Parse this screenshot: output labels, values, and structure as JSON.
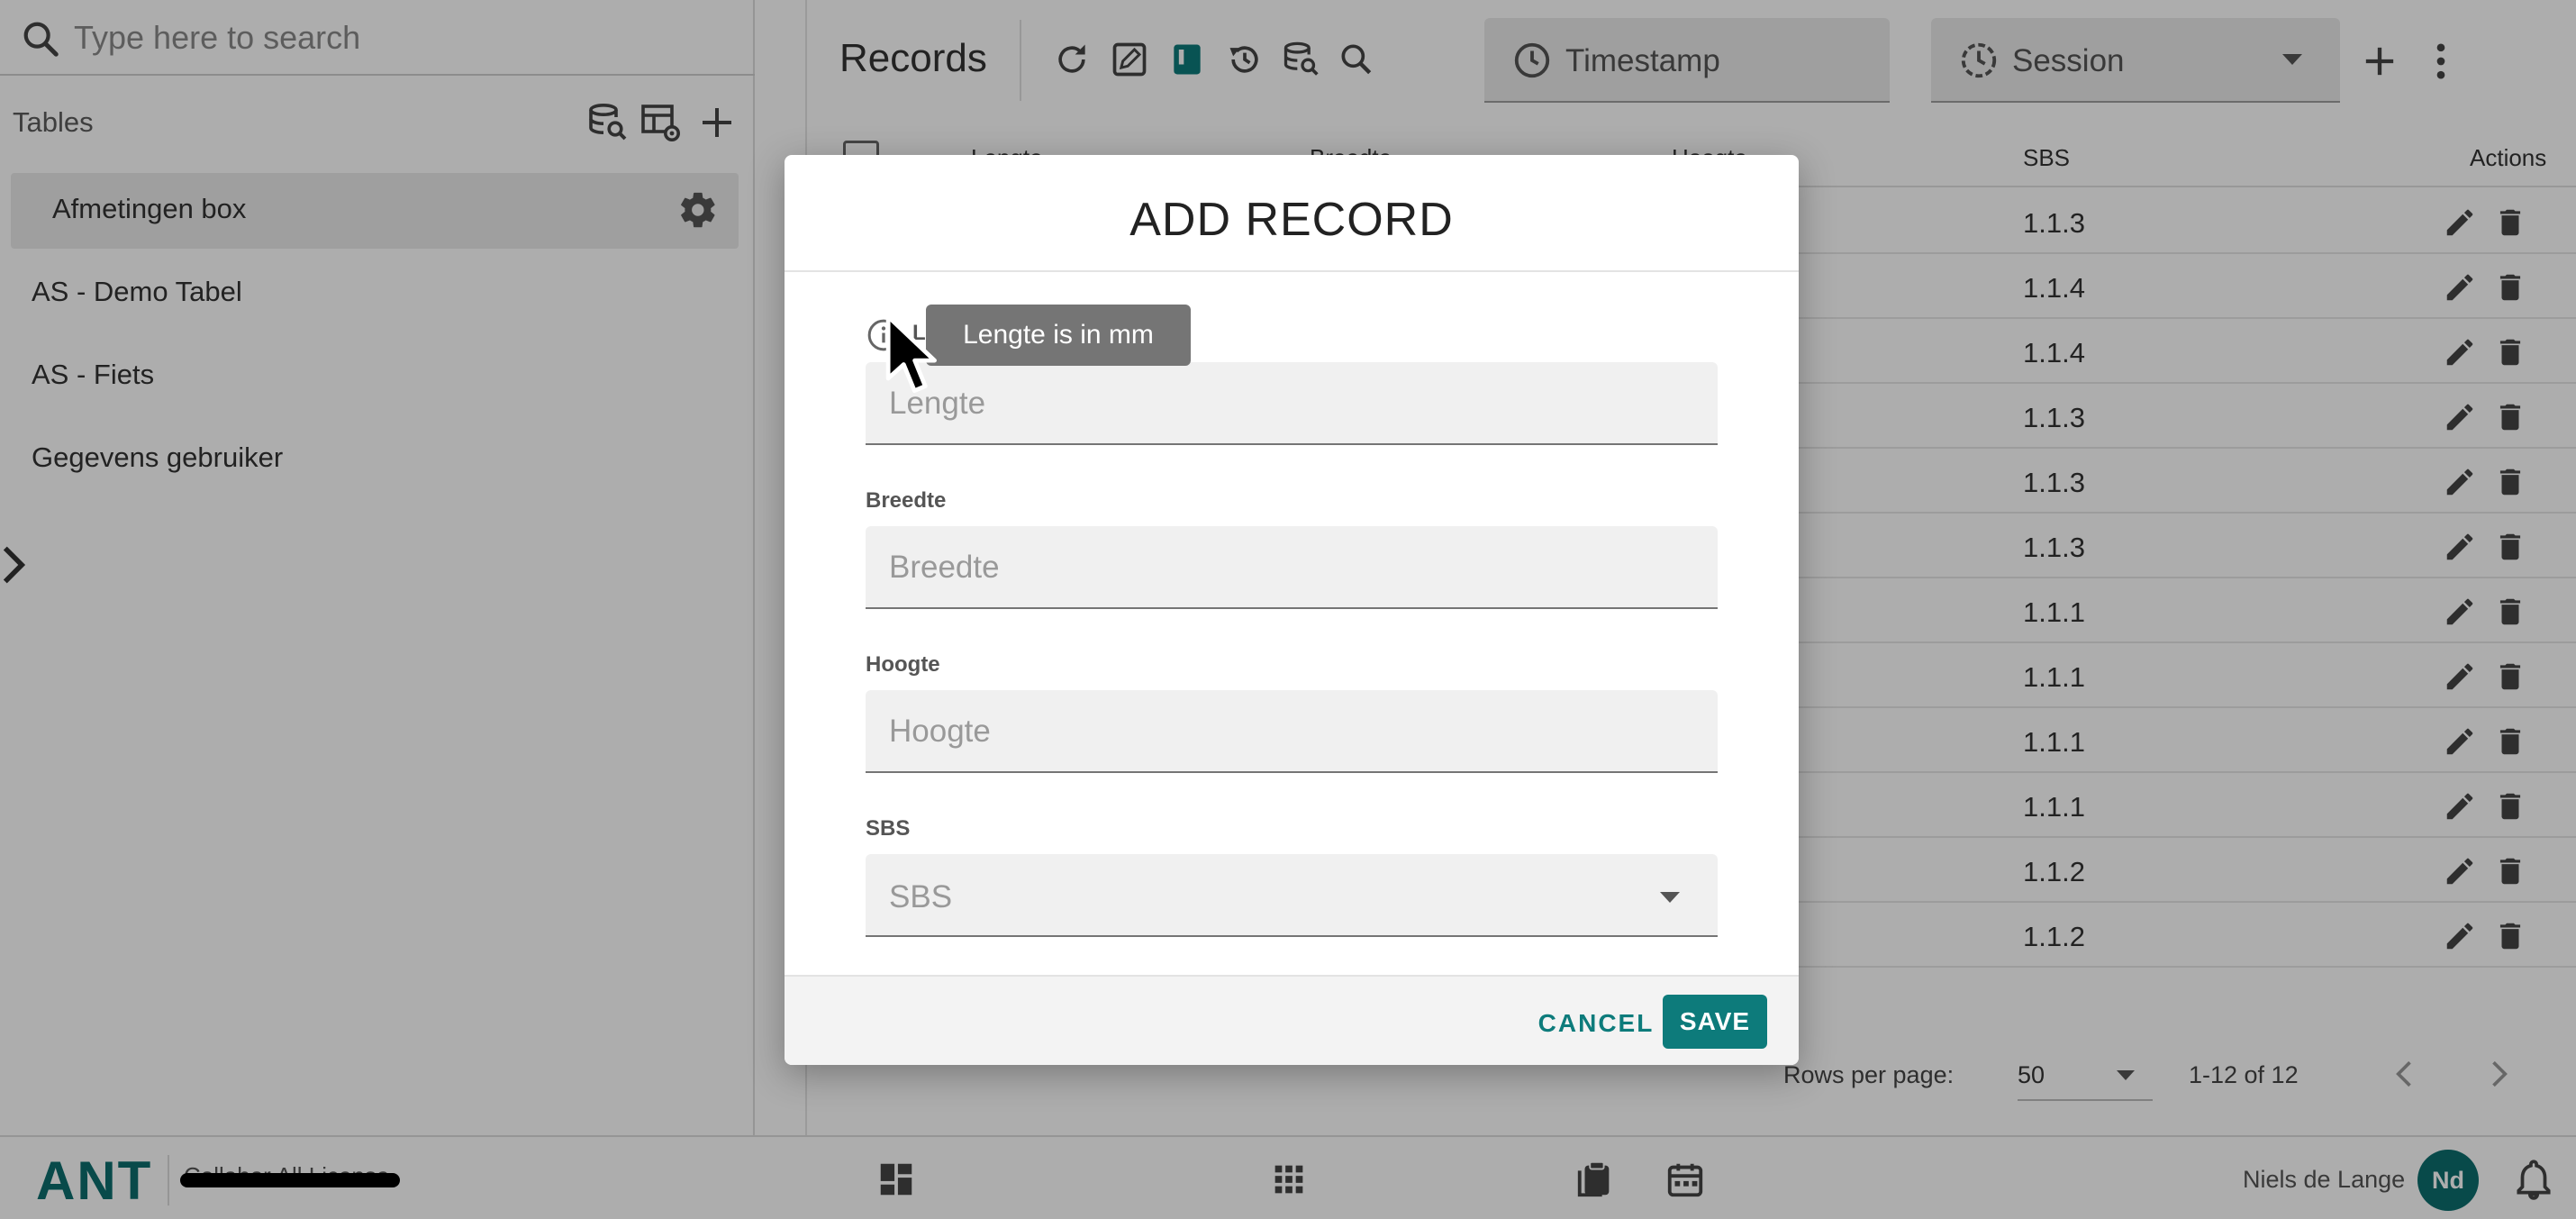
{
  "search": {
    "placeholder": "Type here to search"
  },
  "tables": {
    "title": "Tables",
    "items": [
      {
        "label": "Afmetingen box"
      },
      {
        "label": "AS - Demo Tabel"
      },
      {
        "label": "AS - Fiets"
      },
      {
        "label": "Gegevens gebruiker"
      }
    ]
  },
  "records": {
    "title": "Records",
    "filters": {
      "timestamp": "Timestamp",
      "session": "Session"
    },
    "columns": [
      "Lengte",
      "Breedte",
      "Hoogte",
      "SBS",
      "Actions"
    ],
    "rows": [
      {
        "sbs": "1.1.3"
      },
      {
        "sbs": "1.1.4"
      },
      {
        "sbs": "1.1.4"
      },
      {
        "sbs": "1.1.3"
      },
      {
        "sbs": "1.1.3"
      },
      {
        "sbs": "1.1.3"
      },
      {
        "sbs": "1.1.1"
      },
      {
        "sbs": "1.1.1"
      },
      {
        "sbs": "1.1.1"
      },
      {
        "sbs": "1.1.1"
      },
      {
        "sbs": "1.1.2"
      },
      {
        "sbs": "1.1.2"
      }
    ],
    "pagination": {
      "rows_per_page_label": "Rows per page:",
      "rows_per_page": "50",
      "range": "1-12 of 12"
    }
  },
  "dialog": {
    "title": "ADD RECORD",
    "fields": [
      {
        "label": "Lengte",
        "placeholder": "Lengte"
      },
      {
        "label": "Breedte",
        "placeholder": "Breedte"
      },
      {
        "label": "Hoogte",
        "placeholder": "Hoogte"
      },
      {
        "label": "SBS",
        "placeholder": "SBS"
      }
    ],
    "tooltip": "Lengte is in mm",
    "cancel_label": "CANCEL",
    "save_label": "SAVE"
  },
  "bottom_bar": {
    "brand": "ANT",
    "license": "Collabor All License",
    "user_name": "Niels de Lange",
    "user_initials": "Nd"
  },
  "colors": {
    "accent": "#0d7b7b",
    "brand": "#0d6e6e",
    "tooltip": "#757575"
  },
  "icons": {
    "search": "search-icon",
    "gear": "gear-icon",
    "refresh": "refresh-icon",
    "edit": "pencil-icon",
    "delete": "trash-icon",
    "clock": "clock-icon",
    "info": "info-icon",
    "bell": "bell-icon"
  }
}
